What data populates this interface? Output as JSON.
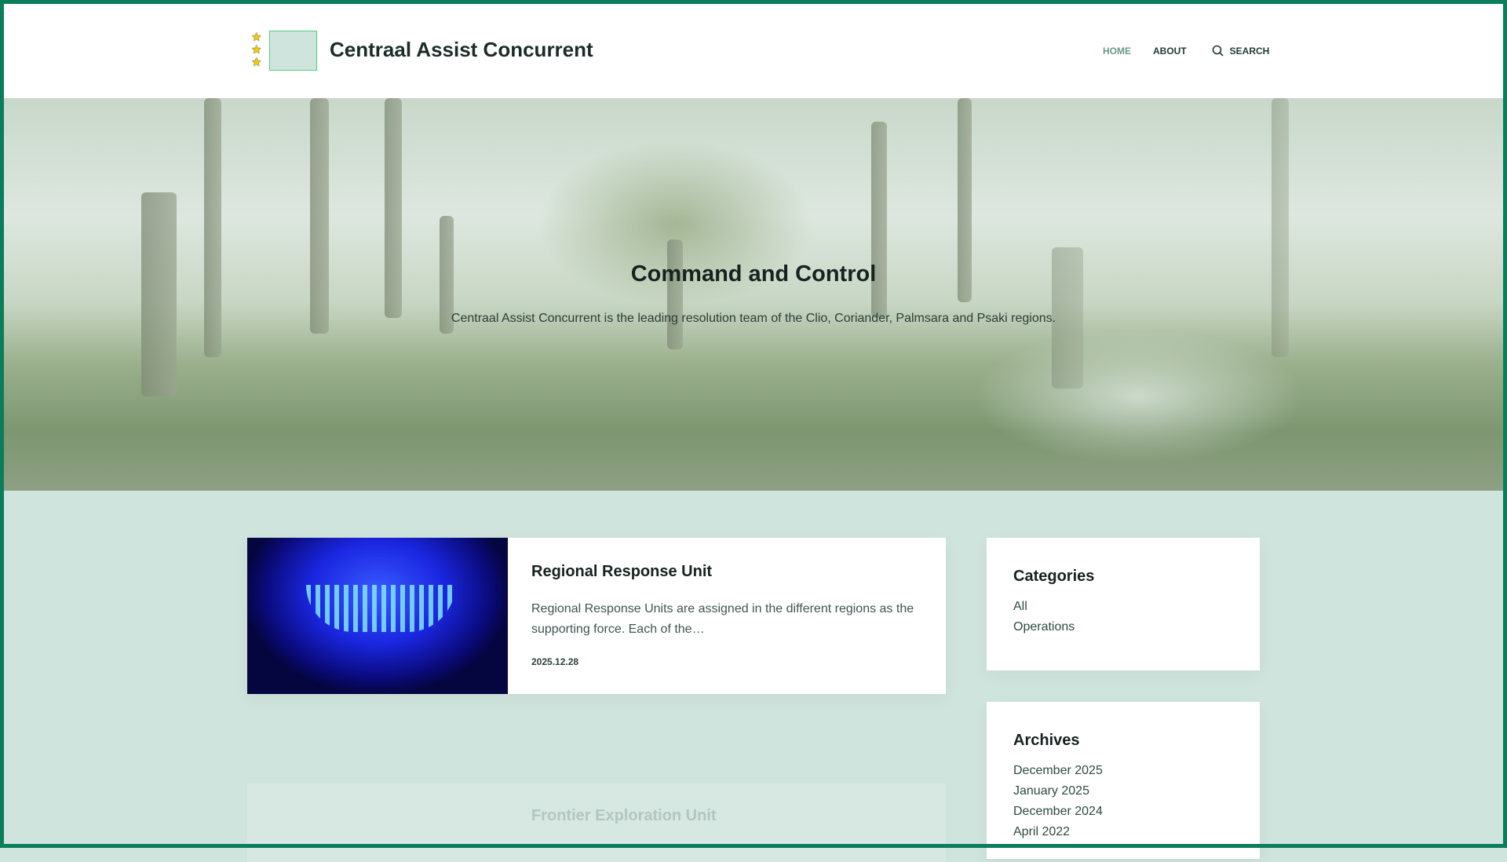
{
  "header": {
    "site_title": "Centraal Assist Concurrent",
    "logo_stars": [
      "★",
      "★",
      "★"
    ],
    "nav": {
      "home": "HOME",
      "about": "ABOUT",
      "search": "SEARCH"
    }
  },
  "hero": {
    "title": "Command and Control",
    "subtitle": "Centraal Assist Concurrent is the leading resolution team of the Clio, Coriander, Palmsara and Psaki regions."
  },
  "posts": [
    {
      "title": "Regional Response Unit",
      "excerpt": "Regional Response Units are assigned in the different regions as the supporting force. Each of the…",
      "date": "2025.12.28"
    },
    {
      "title": "Frontier Exploration Unit"
    }
  ],
  "sidebar": {
    "categories": {
      "title": "Categories",
      "items": [
        "All",
        "Operations"
      ]
    },
    "archives": {
      "title": "Archives",
      "items": [
        "December 2025",
        "January 2025",
        "December 2024",
        "April 2022"
      ]
    }
  },
  "colors": {
    "frame": "#0a7d5a",
    "background": "#d0e4de"
  }
}
